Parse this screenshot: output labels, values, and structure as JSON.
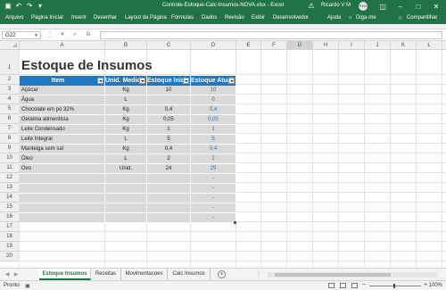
{
  "window": {
    "title": "Controle-Estoque-Calc-Insumos-NOVA.xlsx  -  Excel",
    "user": "Ricardo V M",
    "avatar_initials": "RVM"
  },
  "ribbon": {
    "tabs": [
      "Arquivo",
      "Página Inicial",
      "Inserir",
      "Desenhar",
      "Layout da Página",
      "Fórmulas",
      "Dados",
      "Revisão",
      "Exibir",
      "Desenvolvedor",
      "Ajuda"
    ],
    "tell_me": "Diga-me",
    "share": "Compartilhar"
  },
  "formula_bar": {
    "name_box": "G22",
    "fx": "fx",
    "value": ""
  },
  "columns": [
    "A",
    "B",
    "C",
    "D",
    "E",
    "F",
    "G",
    "H",
    "I",
    "J",
    "K",
    "L",
    "M"
  ],
  "selected_column": "G",
  "rows": [
    "1",
    "2",
    "3",
    "4",
    "5",
    "6",
    "7",
    "8",
    "9",
    "10",
    "11",
    "12",
    "13",
    "14",
    "15",
    "16",
    "17",
    "18",
    "19",
    "20"
  ],
  "sheet": {
    "title": "Estoque de Insumos",
    "headers": [
      "Item",
      "Unid. Medida",
      "Estoque Inicial",
      "Estoque Atual"
    ],
    "data": [
      [
        "Açúcar",
        "Kg",
        "10",
        "10"
      ],
      [
        "Água",
        "L",
        "",
        "0"
      ],
      [
        "Chocolate em pó 32%",
        "Kg",
        "0,4",
        "0,4"
      ],
      [
        "Gelatina alimentícia",
        "Kg",
        "0,05",
        "0,05"
      ],
      [
        "Leite Condensado",
        "Kg",
        "1",
        "1"
      ],
      [
        "Leite Integral",
        "L",
        "5",
        "5"
      ],
      [
        "Manteiga sem sal",
        "Kg",
        "0,4",
        "0,4"
      ],
      [
        "Óleo",
        "L",
        "2",
        "2"
      ],
      [
        "Ovo",
        "Unid.",
        "24",
        "29"
      ],
      [
        "",
        "",
        "",
        "-"
      ],
      [
        "",
        "",
        "",
        "-"
      ],
      [
        "",
        "",
        "",
        "-"
      ],
      [
        "",
        "",
        "",
        "-"
      ],
      [
        "",
        "",
        "",
        "-"
      ]
    ]
  },
  "sheet_tabs": {
    "tabs": [
      "Estoque Insumos",
      "Receitas",
      "Movimentacoes",
      "Calc Insumos"
    ],
    "active": 0,
    "add": "+"
  },
  "status": {
    "ready": "Pronto",
    "zoom": "100%"
  }
}
